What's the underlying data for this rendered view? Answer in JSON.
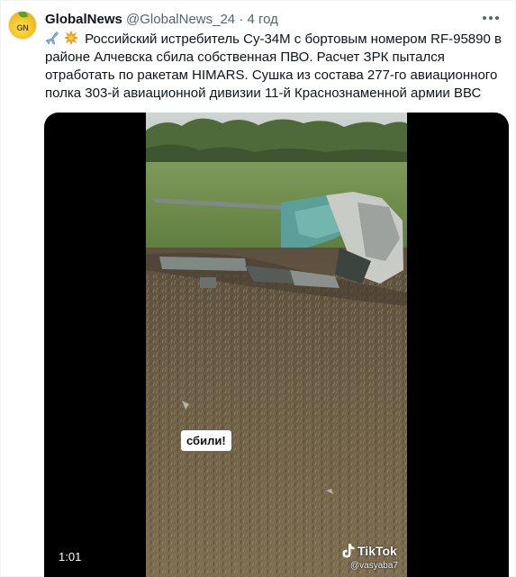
{
  "author": {
    "name": "GlobalNews",
    "handle": "@GlobalNews_24",
    "separator": "·",
    "time": "4 год",
    "avatar_text": "GN"
  },
  "tweet": {
    "text": "Российский истребитель Су-34М с бортовым номером RF-95890 в районе Алчевска сбила собственная ПВО. Расчет ЗРК пытался отработать по ракетам HIMARS. Сушка из состава 277-го авиационного полка 303-й авиационной дивизии 11-й Краснознаменной армии ВВС",
    "emojis": [
      "airplane-icon",
      "collision-icon"
    ]
  },
  "video": {
    "caption": "сбили!",
    "duration": "1:01",
    "watermark": "TikTok",
    "username": "@vasyaba7"
  },
  "colors": {
    "text": "#0f1419",
    "secondary": "#536471",
    "media_bg": "#000000"
  }
}
